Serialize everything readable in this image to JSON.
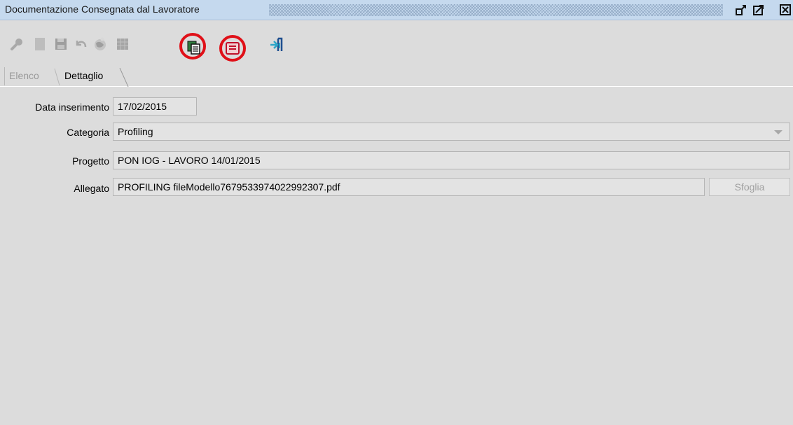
{
  "window": {
    "title": "Documentazione Consegnata dal Lavoratore",
    "controls": [
      "restore-icon",
      "maximize-icon",
      "close-icon"
    ]
  },
  "toolbar": {
    "buttons": [
      {
        "name": "search-icon",
        "enabled": false
      },
      {
        "name": "new-document-icon",
        "enabled": false
      },
      {
        "name": "save-icon",
        "enabled": false
      },
      {
        "name": "undo-icon",
        "enabled": false
      },
      {
        "name": "globe-icon",
        "enabled": false
      },
      {
        "name": "delete-icon",
        "enabled": false
      },
      {
        "name": "copy-documents-icon",
        "enabled": true,
        "highlighted": true
      },
      {
        "name": "pdf-icon",
        "enabled": true,
        "highlighted": true
      },
      {
        "name": "exit-icon",
        "enabled": true
      }
    ],
    "highlight_color": "#e01018"
  },
  "tabs": [
    {
      "label": "Elenco",
      "active": false
    },
    {
      "label": "Dettaglio",
      "active": true
    }
  ],
  "form": {
    "data_inserimento": {
      "label": "Data inserimento",
      "value": "17/02/2015"
    },
    "categoria": {
      "label": "Categoria",
      "value": "Profiling"
    },
    "progetto": {
      "label": "Progetto",
      "value": "PON IOG - LAVORO 14/01/2015"
    },
    "allegato": {
      "label": "Allegato",
      "value": "PROFILING fileModello7679533974022992307.pdf",
      "browse_label": "Sfoglia"
    }
  }
}
